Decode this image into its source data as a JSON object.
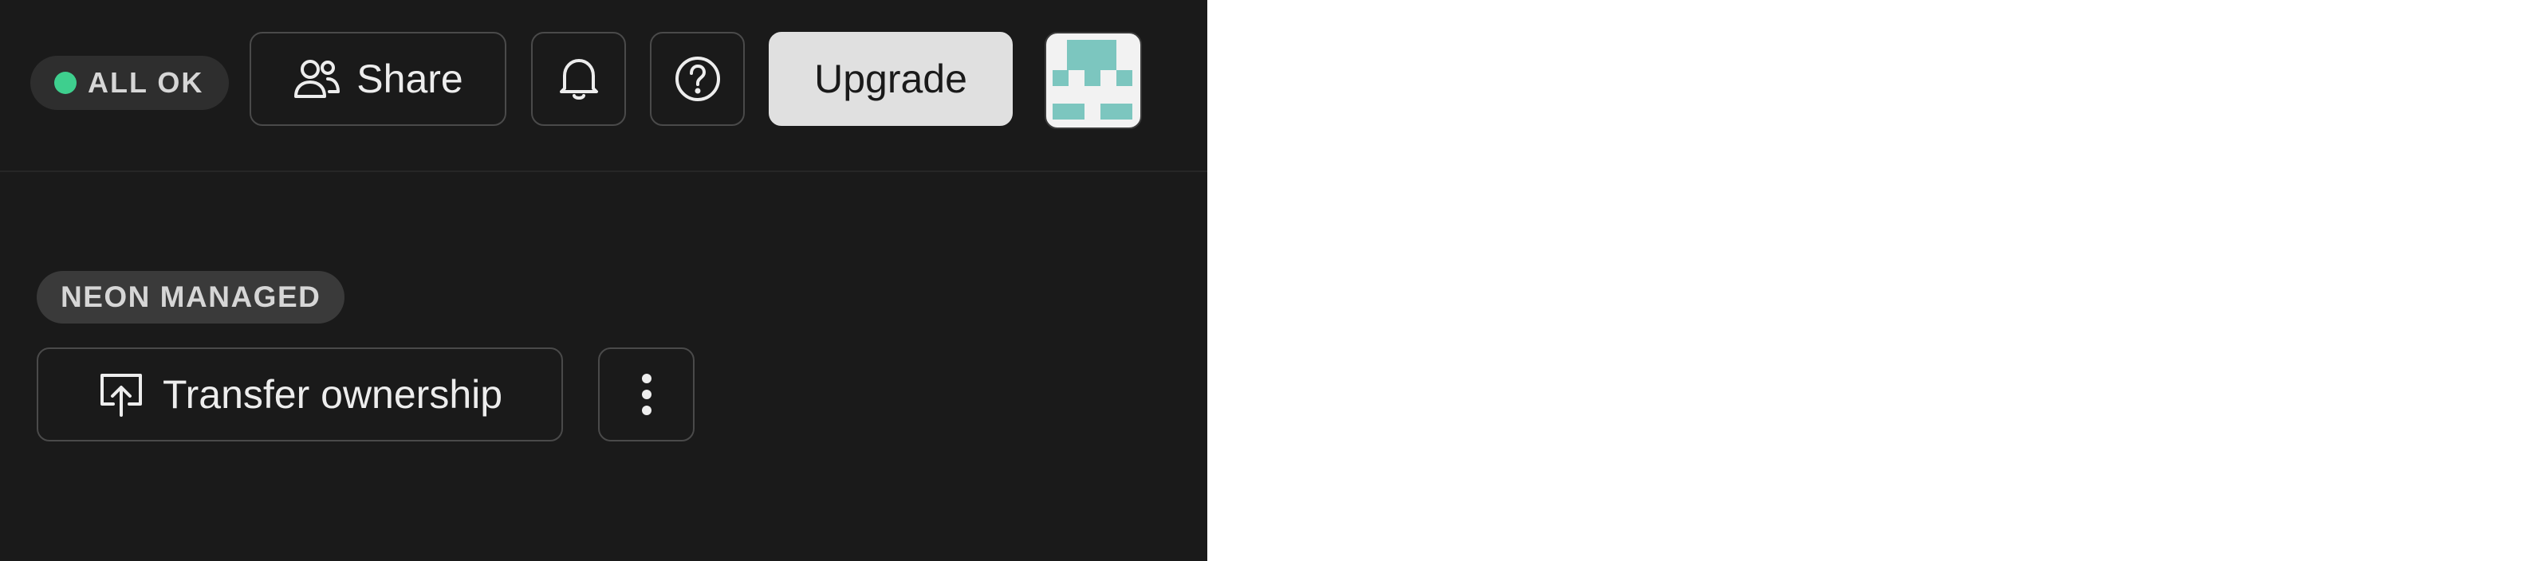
{
  "header": {
    "status": {
      "label": "ALL OK",
      "color": "#3ecf8e"
    },
    "share_button": {
      "label": "Share",
      "icon": "users-icon"
    },
    "notifications_button": {
      "icon": "bell-icon"
    },
    "help_button": {
      "icon": "question-circle-icon"
    },
    "upgrade_button": {
      "label": "Upgrade"
    },
    "avatar": {
      "icon": "identicon-avatar",
      "color": "#7cc6bf"
    }
  },
  "main": {
    "badge": "NEON MANAGED",
    "transfer_button": {
      "label": "Transfer ownership",
      "icon": "upload-box-icon"
    },
    "more_button": {
      "icon": "vertical-ellipsis-icon"
    }
  }
}
